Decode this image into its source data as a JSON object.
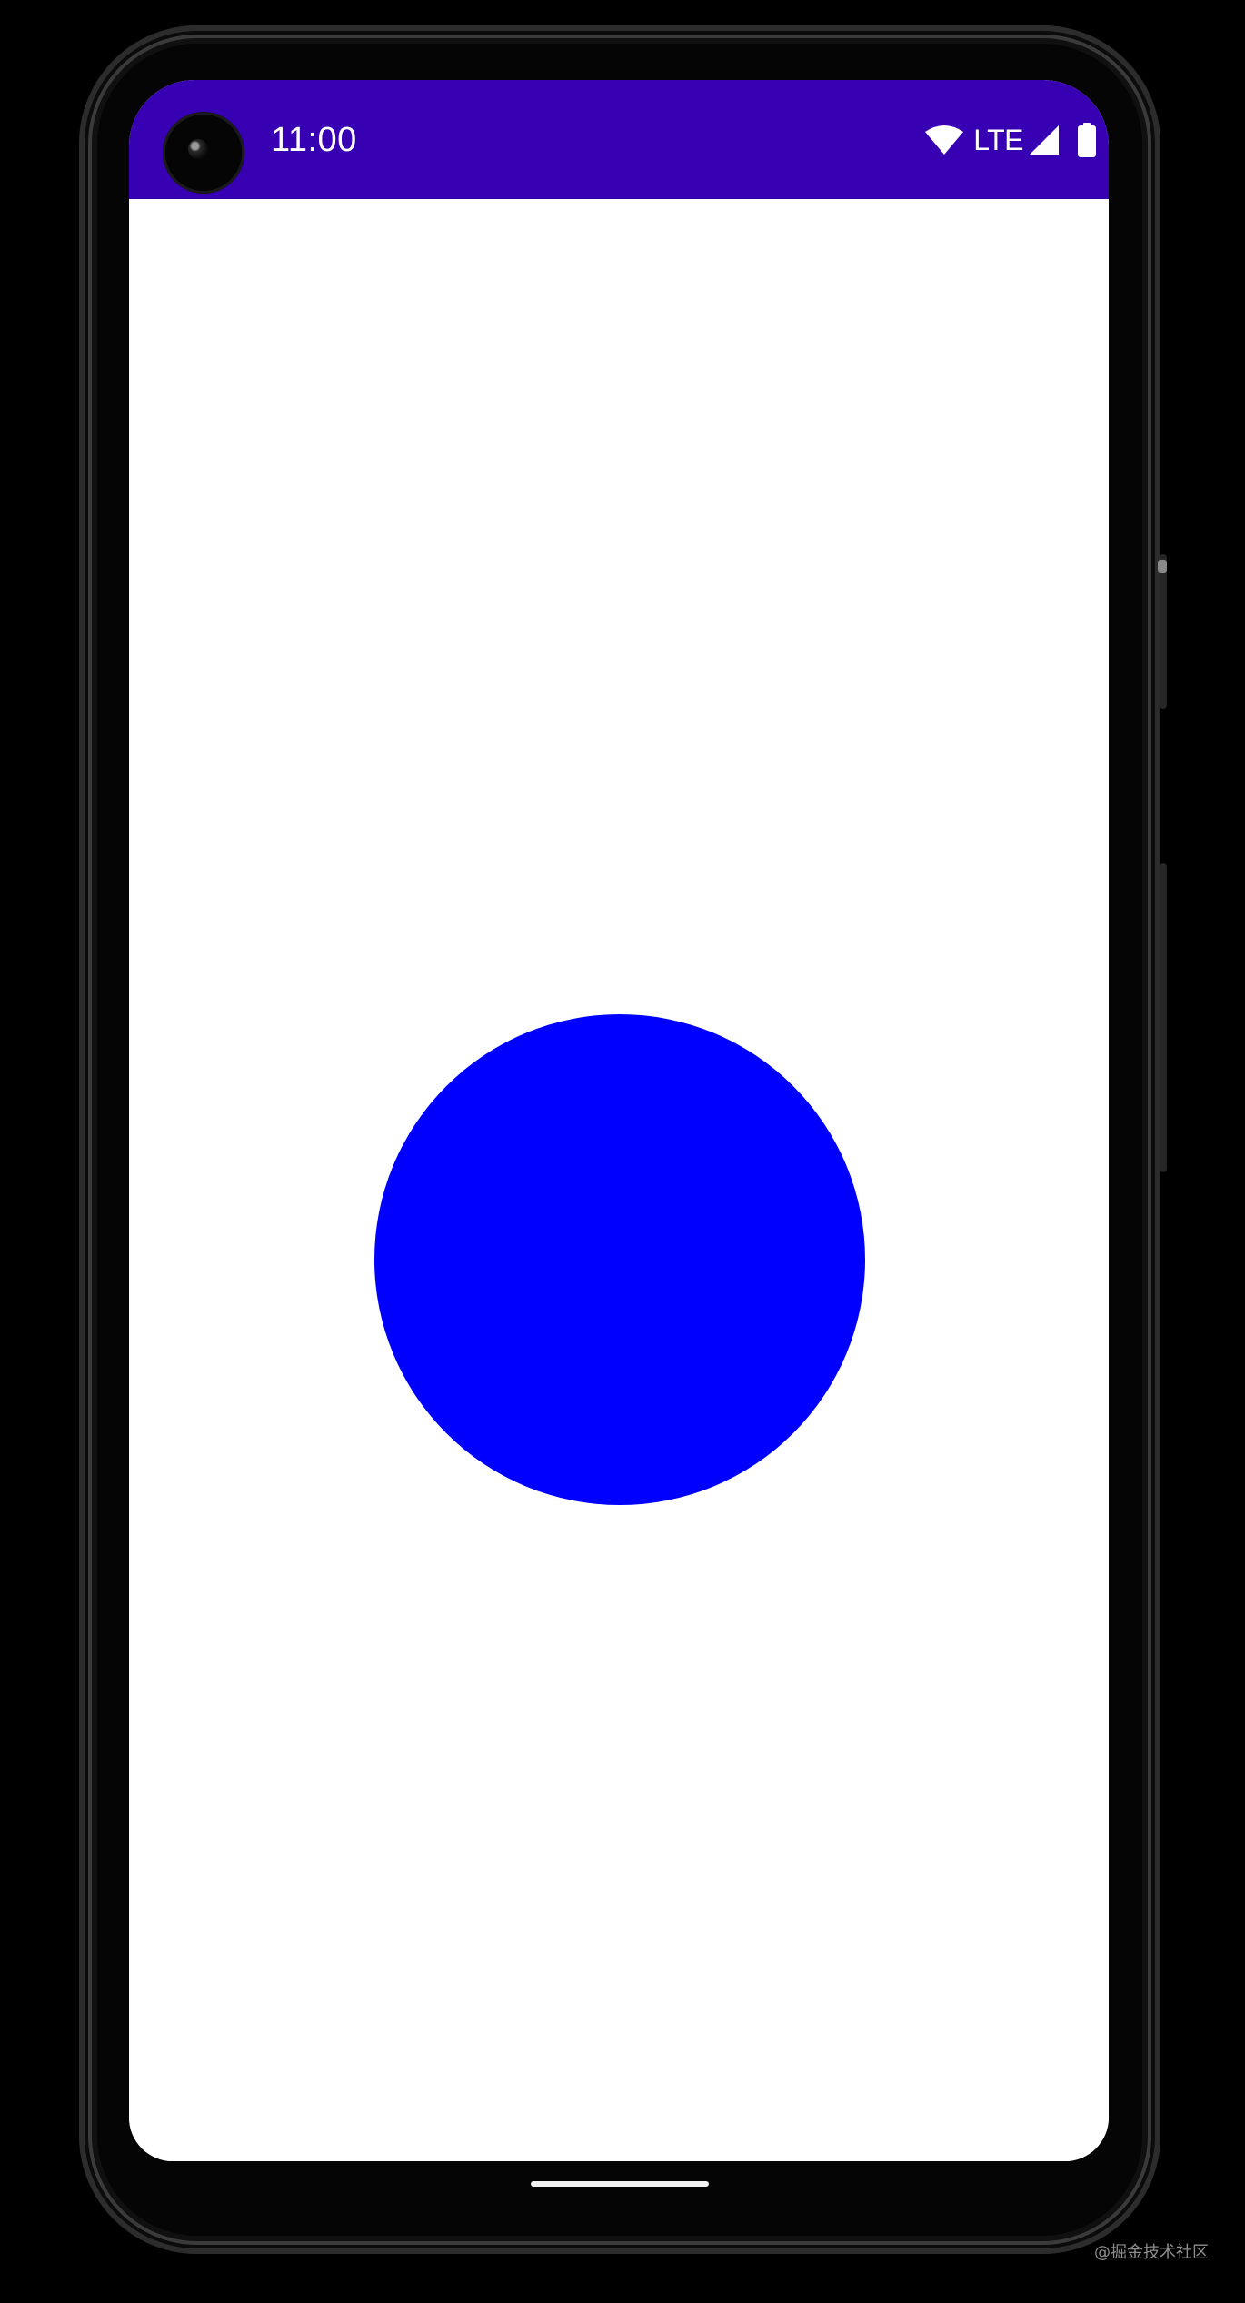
{
  "status_bar": {
    "time": "11:00",
    "network_label": "LTE",
    "background_color": "#3700B3",
    "icons": [
      "camera-cutout-icon",
      "wifi-icon",
      "signal-icon",
      "battery-icon"
    ]
  },
  "content": {
    "background_color": "#FFFFFF",
    "circle_color": "#0000FF"
  },
  "navigation": {
    "gesture_bar_icon": "home-gesture-bar"
  },
  "watermark": {
    "text": "@掘金技术社区"
  }
}
